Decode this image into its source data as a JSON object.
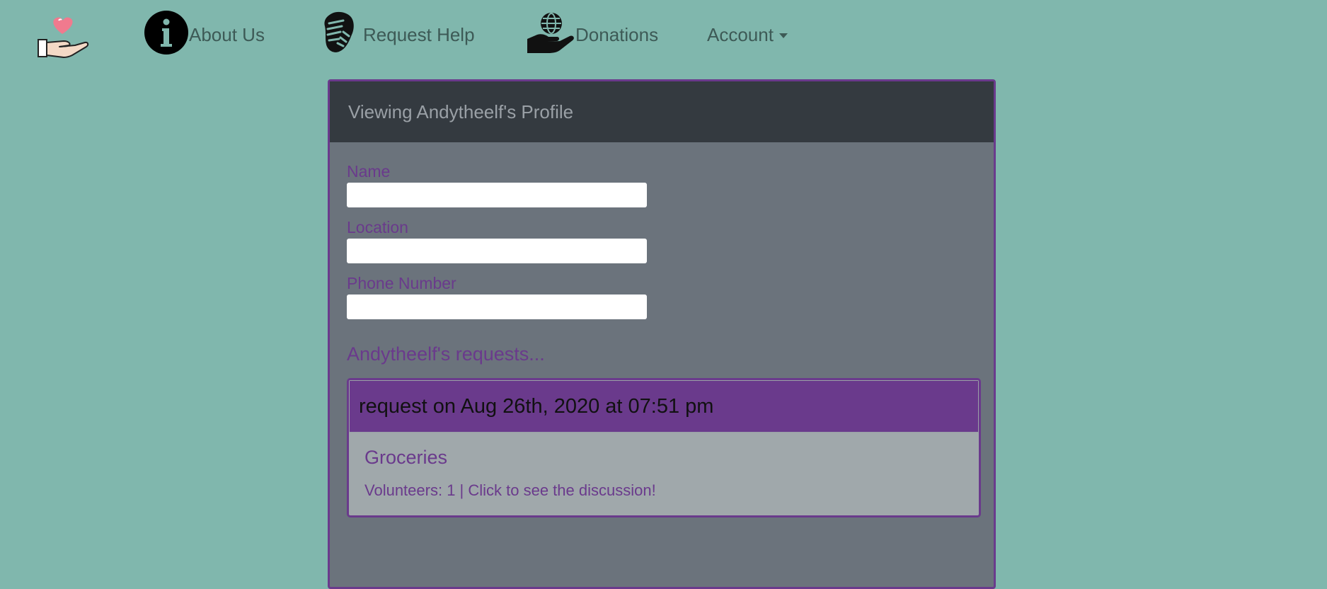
{
  "nav": {
    "about_label": "About Us",
    "request_label": "Request Help",
    "donations_label": "Donations",
    "account_label": "Account"
  },
  "icons": {
    "brand": "heart-hand-icon",
    "about": "info-icon",
    "request": "handshake-icon",
    "donations": "globe-hand-icon",
    "account": "caret-down-icon"
  },
  "colors": {
    "page_bg": "#80b7ad",
    "accent": "#6a3a8c",
    "card_bg": "#6b737c",
    "card_header_bg": "#343a40",
    "request_body_bg": "#a0a8ab"
  },
  "profile": {
    "title": "Viewing Andytheelf's Profile",
    "name_label": "Name",
    "name_value": "",
    "location_label": "Location",
    "location_value": "",
    "phone_label": "Phone Number",
    "phone_value": ""
  },
  "requests": {
    "heading": "Andytheelf's requests...",
    "items": [
      {
        "header": "request on Aug 26th, 2020 at 07:51 pm",
        "title": "Groceries",
        "meta": "Volunteers: 1 | Click to see the discussion!"
      }
    ]
  }
}
